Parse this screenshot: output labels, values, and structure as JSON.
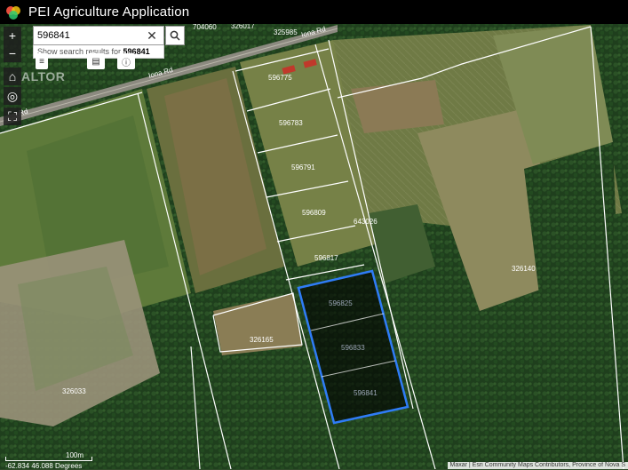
{
  "app": {
    "title": "PEI Agriculture Application"
  },
  "search": {
    "value": "596841",
    "suggestion_prefix": "Show search results for ",
    "suggestion_term": "596841"
  },
  "map": {
    "road_name": "Iona Rd",
    "road_name_2": "Iona Rd",
    "road_name_3": "Rd",
    "watermark": "ALTOR",
    "selected_parcel": "596841",
    "parcel_labels": [
      "704060",
      "326017",
      "325985",
      "596775",
      "596783",
      "596791",
      "596809",
      "643026",
      "596817",
      "596825",
      "596833",
      "596841",
      "326140",
      "326165",
      "326033"
    ],
    "scale_label": "100m",
    "coordinates": "-62.834 46.088 Degrees",
    "attribution": "Maxar | Esri Community Maps Contributors, Province of Nova S",
    "colors": {
      "selection": "#2f7cf6",
      "parcel_line": "#ffffff"
    }
  },
  "icons": [
    "logo-icon",
    "search-icon",
    "clear-icon",
    "zoom-in-icon",
    "zoom-out-icon",
    "home-icon",
    "locate-icon",
    "fullscreen-icon",
    "list-icon",
    "print-icon",
    "info-icon"
  ]
}
